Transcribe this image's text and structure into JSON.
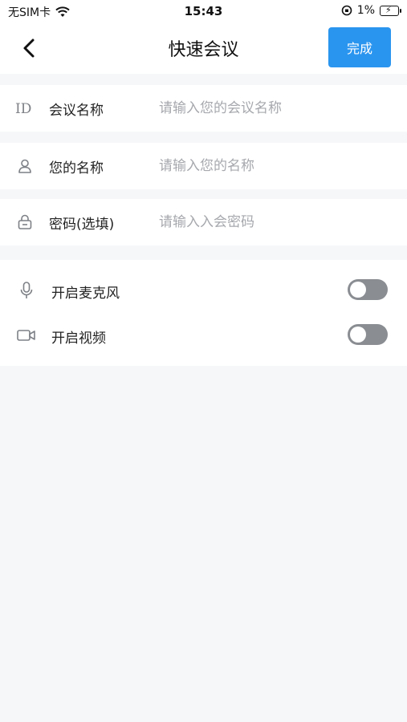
{
  "status_bar": {
    "carrier": "无SIM卡",
    "time": "15:43",
    "battery": "1%"
  },
  "nav": {
    "title": "快速会议",
    "done_label": "完成"
  },
  "form": {
    "meeting_name": {
      "label": "会议名称",
      "placeholder": "请输入您的会议名称",
      "value": "",
      "icon": "id-icon"
    },
    "your_name": {
      "label": "您的名称",
      "placeholder": "请输入您的名称",
      "value": "",
      "icon": "person-icon"
    },
    "password": {
      "label": "密码(选填)",
      "placeholder": "请输入入会密码",
      "value": "",
      "icon": "lock-icon"
    }
  },
  "toggles": {
    "microphone": {
      "label": "开启麦克风",
      "on": false,
      "icon": "microphone-icon"
    },
    "video": {
      "label": "开启视频",
      "on": false,
      "icon": "video-camera-icon"
    }
  },
  "colors": {
    "accent": "#2a95ef",
    "background": "#f6f7f9",
    "placeholder": "#a6a8ad",
    "switch_off": "#8a8d92"
  }
}
